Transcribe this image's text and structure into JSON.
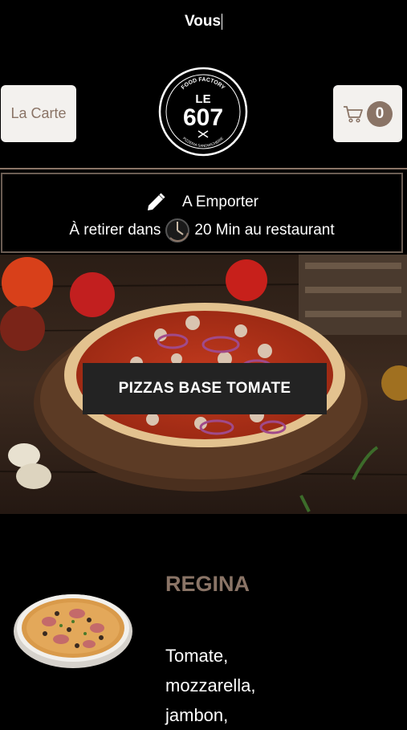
{
  "header": {
    "title": "Vous"
  },
  "nav": {
    "menu_label": "La Carte",
    "cart_count": "0",
    "cart_icon": "cart-icon",
    "logo": {
      "top_text": "FOOD FACTORY",
      "line1": "LE",
      "line2": "607",
      "bottom_text": "PIZZERIA SANDWICHERIE"
    }
  },
  "order_info": {
    "mode": "A Emporter",
    "pickup_prefix": "À retirer dans",
    "pickup_time": "20 Min au restaurant"
  },
  "category": {
    "title": "PIZZAS BASE TOMATE"
  },
  "products": [
    {
      "name": "REGINA",
      "description_lines": [
        "Tomate,",
        "mozzarella,",
        "jambon,"
      ]
    }
  ],
  "colors": {
    "accent": "#8a7466",
    "background": "#000000",
    "button_bg": "#f3f1ee",
    "banner_bg": "#232323"
  }
}
